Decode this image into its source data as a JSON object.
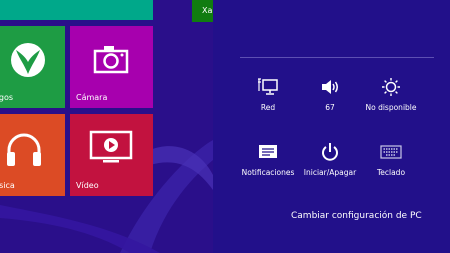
{
  "start_screen": {
    "green_small_tile_label": "Xa",
    "tiles": {
      "games": "egos",
      "camera": "Cámara",
      "music": "úsica",
      "video": "Vídeo"
    }
  },
  "settings_pane": {
    "quick_settings": {
      "network": {
        "label": "Red",
        "icon": "network-icon"
      },
      "volume": {
        "label": "67",
        "icon": "speaker-icon"
      },
      "brightness": {
        "label": "No disponible",
        "icon": "brightness-icon"
      },
      "notifications": {
        "label": "Notificaciones",
        "icon": "notifications-icon"
      },
      "power": {
        "label": "Iniciar/Apagar",
        "icon": "power-icon"
      },
      "keyboard": {
        "label": "Teclado",
        "icon": "keyboard-icon"
      }
    },
    "change_settings_link": "Cambiar configuración de PC"
  },
  "colors": {
    "start_background": "#2a0f8a",
    "pane_background": "#22108a",
    "tile_games": "#1e9c44",
    "tile_camera": "#a700ae",
    "tile_music": "#dc4b25",
    "tile_video": "#c2123f",
    "tile_top": "#00a88a"
  }
}
